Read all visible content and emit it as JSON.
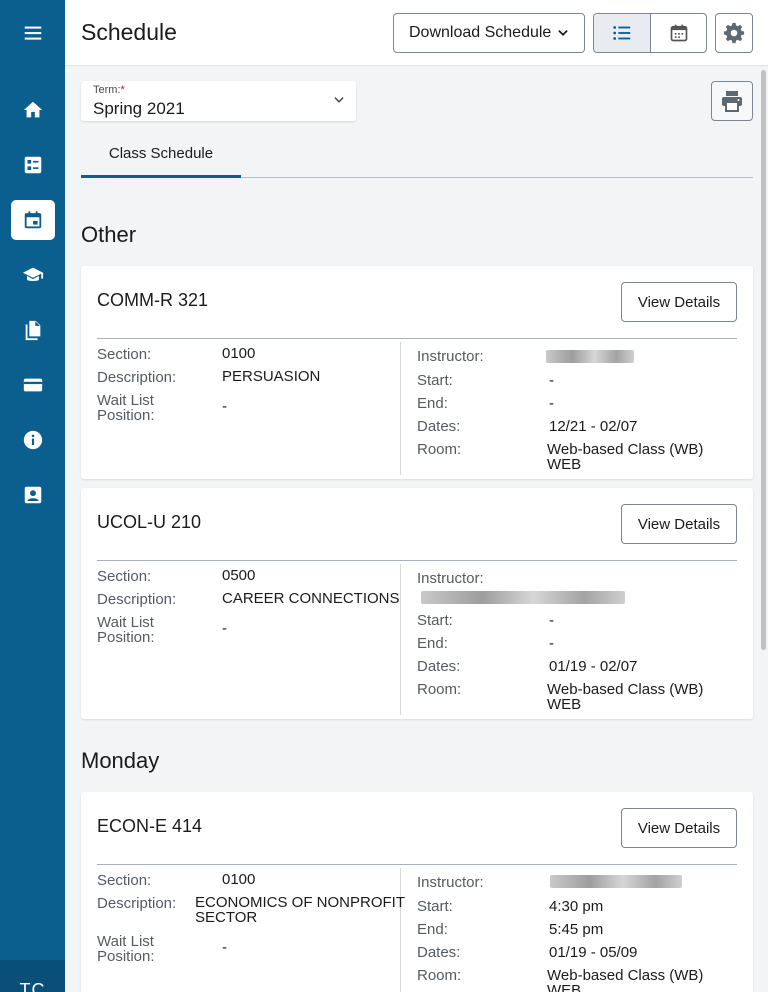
{
  "app": {
    "title": "Schedule",
    "download_label": "Download Schedule"
  },
  "sidebar": {
    "items": [
      {
        "icon": "home-icon",
        "active": false
      },
      {
        "icon": "student-center-icon",
        "active": false
      },
      {
        "icon": "calendar-icon",
        "active": true
      },
      {
        "icon": "graduation-cap-icon",
        "active": false
      },
      {
        "icon": "documents-icon",
        "active": false
      },
      {
        "icon": "credit-card-icon",
        "active": false
      },
      {
        "icon": "info-icon",
        "active": false
      },
      {
        "icon": "profile-icon",
        "active": false
      }
    ],
    "avatar_initials": "TC"
  },
  "term": {
    "label": "Term:",
    "required_mark": "*",
    "value": "Spring 2021"
  },
  "tabs": [
    {
      "label": "Class Schedule",
      "active": true
    }
  ],
  "groups": [
    {
      "heading": "Other",
      "classes": [
        {
          "course": "COMM-R 321",
          "view_details": "View Details",
          "section_label": "Section:",
          "section": "0100",
          "description_label": "Description:",
          "description": "PERSUASION",
          "waitlist_label": "Wait List Position:",
          "waitlist": "-",
          "instructor_label": "Instructor:",
          "start_label": "Start:",
          "start": "-",
          "end_label": "End:",
          "end": "-",
          "dates_label": "Dates:",
          "dates": "12/21 - 02/07",
          "room_label": "Room:",
          "room": "Web-based Class (WB) WEB"
        },
        {
          "course": "UCOL-U 210",
          "view_details": "View Details",
          "section_label": "Section:",
          "section": "0500",
          "description_label": "Description:",
          "description": "CAREER CONNECTIONS",
          "waitlist_label": "Wait List Position:",
          "waitlist": "-",
          "instructor_label": "Instructor:",
          "start_label": "Start:",
          "start": "-",
          "end_label": "End:",
          "end": "-",
          "dates_label": "Dates:",
          "dates": "01/19 - 02/07",
          "room_label": "Room:",
          "room": "Web-based Class (WB) WEB"
        }
      ]
    },
    {
      "heading": "Monday",
      "classes": [
        {
          "course": "ECON-E 414",
          "view_details": "View Details",
          "section_label": "Section:",
          "section": "0100",
          "description_label": "Description:",
          "description": "ECONOMICS OF NONPROFIT SECTOR",
          "waitlist_label": "Wait List Position:",
          "waitlist": "-",
          "instructor_label": "Instructor:",
          "start_label": "Start:",
          "start": "4:30 pm",
          "end_label": "End:",
          "end": "5:45 pm",
          "dates_label": "Dates:",
          "dates": "01/19 - 05/09",
          "room_label": "Room:",
          "room": "Web-based Class (WB) WEB"
        }
      ]
    }
  ],
  "colors": {
    "sidebar": "#0b5f8f",
    "accent": "#0b5f8f",
    "required": "#c8102e"
  }
}
